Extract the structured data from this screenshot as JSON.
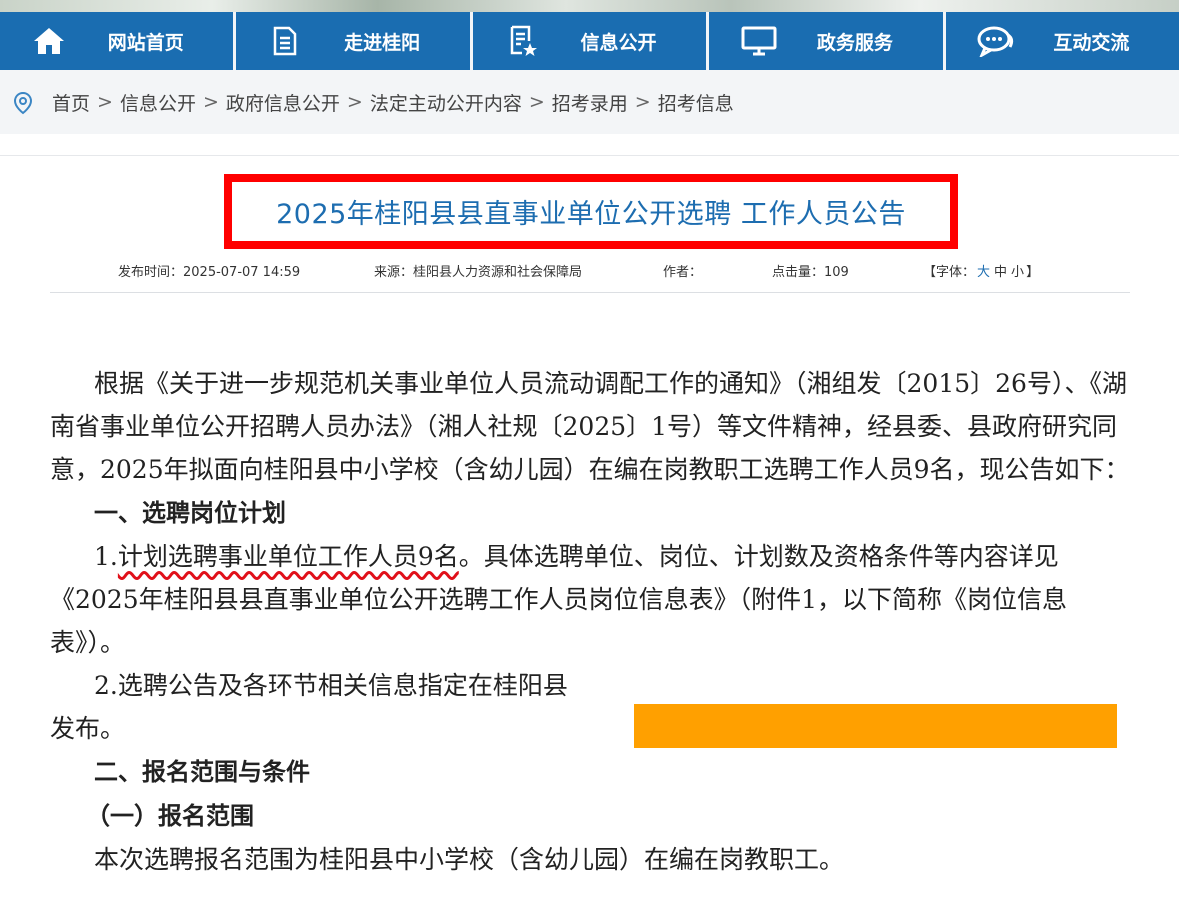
{
  "nav": {
    "items": [
      {
        "label": "网站首页",
        "icon": "home-icon"
      },
      {
        "label": "走进桂阳",
        "icon": "document-icon"
      },
      {
        "label": "信息公开",
        "icon": "document-star-icon"
      },
      {
        "label": "政务服务",
        "icon": "monitor-icon"
      },
      {
        "label": "互动交流",
        "icon": "chat-icon"
      }
    ]
  },
  "breadcrumb": {
    "icon": "location-pin-icon",
    "items": [
      "首页",
      "信息公开",
      "政府信息公开",
      "法定主动公开内容",
      "招考录用",
      "招考信息"
    ],
    "separator": ">"
  },
  "article": {
    "title": "2025年桂阳县县直事业单位公开选聘 工作人员公告",
    "meta": {
      "publish_time": "发布时间：2025-07-07 14:59",
      "source": "来源：桂阳县人力资源和社会保障局",
      "author": "作者：",
      "clicks": "点击量：109",
      "font_label_prefix": "【字体：",
      "font_large": "大",
      "font_medium": "中",
      "font_small": "小",
      "font_label_suffix": "】"
    },
    "p1": "根据《关于进一步规范机关事业单位人员流动调配工作的通知》（湘组发〔2015〕26号）、《湖南省事业单位公开招聘人员办法》（湘人社规〔2025〕1号）等文件精神，经县委、县政府研究同意，2025年拟面向桂阳县中小学校（含幼儿园）在编在岗教职工选聘工作人员9名，现公告如下：",
    "h1": "一、选聘岗位计划",
    "p2_num": "1.",
    "p2_highlight": "计划选聘事业单位工作人员9名",
    "p2_rest": "。具体选聘单位、岗位、计划数及资格条件等内容详见《2025年桂阳县县直事业单位公开选聘工作人员岗位信息表》（附件1，以下简称《岗位信息表》）。",
    "p3": "2.选聘公告及各环节相关信息指定在桂阳县",
    "p3_end": "发布。",
    "h2": "二、报名范围与条件",
    "h3": "（一）报名范围",
    "p4": "本次选聘报名范围为桂阳县中小学校（含幼儿园）在编在岗教职工。"
  },
  "colors": {
    "nav_bg": "#1a6db1",
    "title_color": "#1d6db0",
    "title_border": "#ff0000",
    "redaction": "#ffa000",
    "wavy_underline": "#e0101a"
  }
}
